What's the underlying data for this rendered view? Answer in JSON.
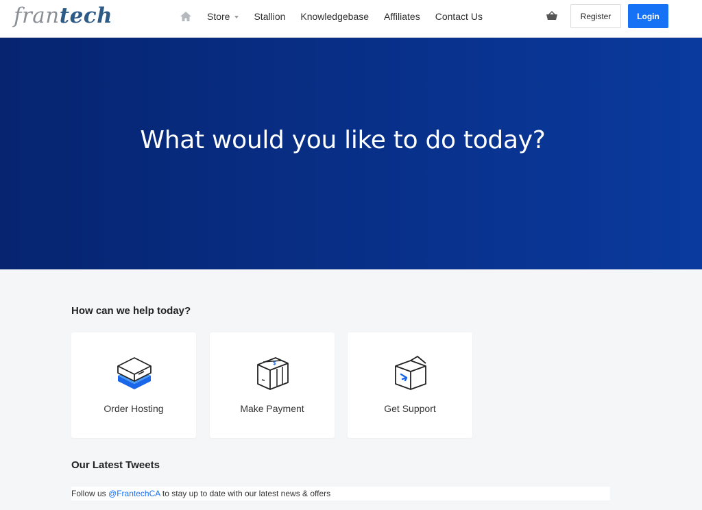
{
  "header": {
    "logo_part1": "fran",
    "logo_part2": "tech",
    "nav": {
      "store": "Store",
      "stallion": "Stallion",
      "knowledgebase": "Knowledgebase",
      "affiliates": "Affiliates",
      "contact": "Contact Us"
    },
    "register_label": "Register",
    "login_label": "Login"
  },
  "hero": {
    "title": "What would you like to do today?"
  },
  "help": {
    "title": "How can we help today?",
    "cards": [
      {
        "label": "Order Hosting",
        "icon": "server-icon"
      },
      {
        "label": "Make Payment",
        "icon": "payment-box-icon"
      },
      {
        "label": "Get Support",
        "icon": "support-box-icon"
      }
    ]
  },
  "tweets": {
    "title": "Our Latest Tweets",
    "follow_prefix": "Follow us ",
    "handle": "@FrantechCA",
    "follow_suffix": " to stay up to date with our latest news & offers"
  },
  "colors": {
    "accent": "#1672f5",
    "hero_start": "#062470",
    "hero_end": "#0a3a9e",
    "logo_gray": "#8a8f96",
    "logo_blue": "#2d5a87"
  }
}
